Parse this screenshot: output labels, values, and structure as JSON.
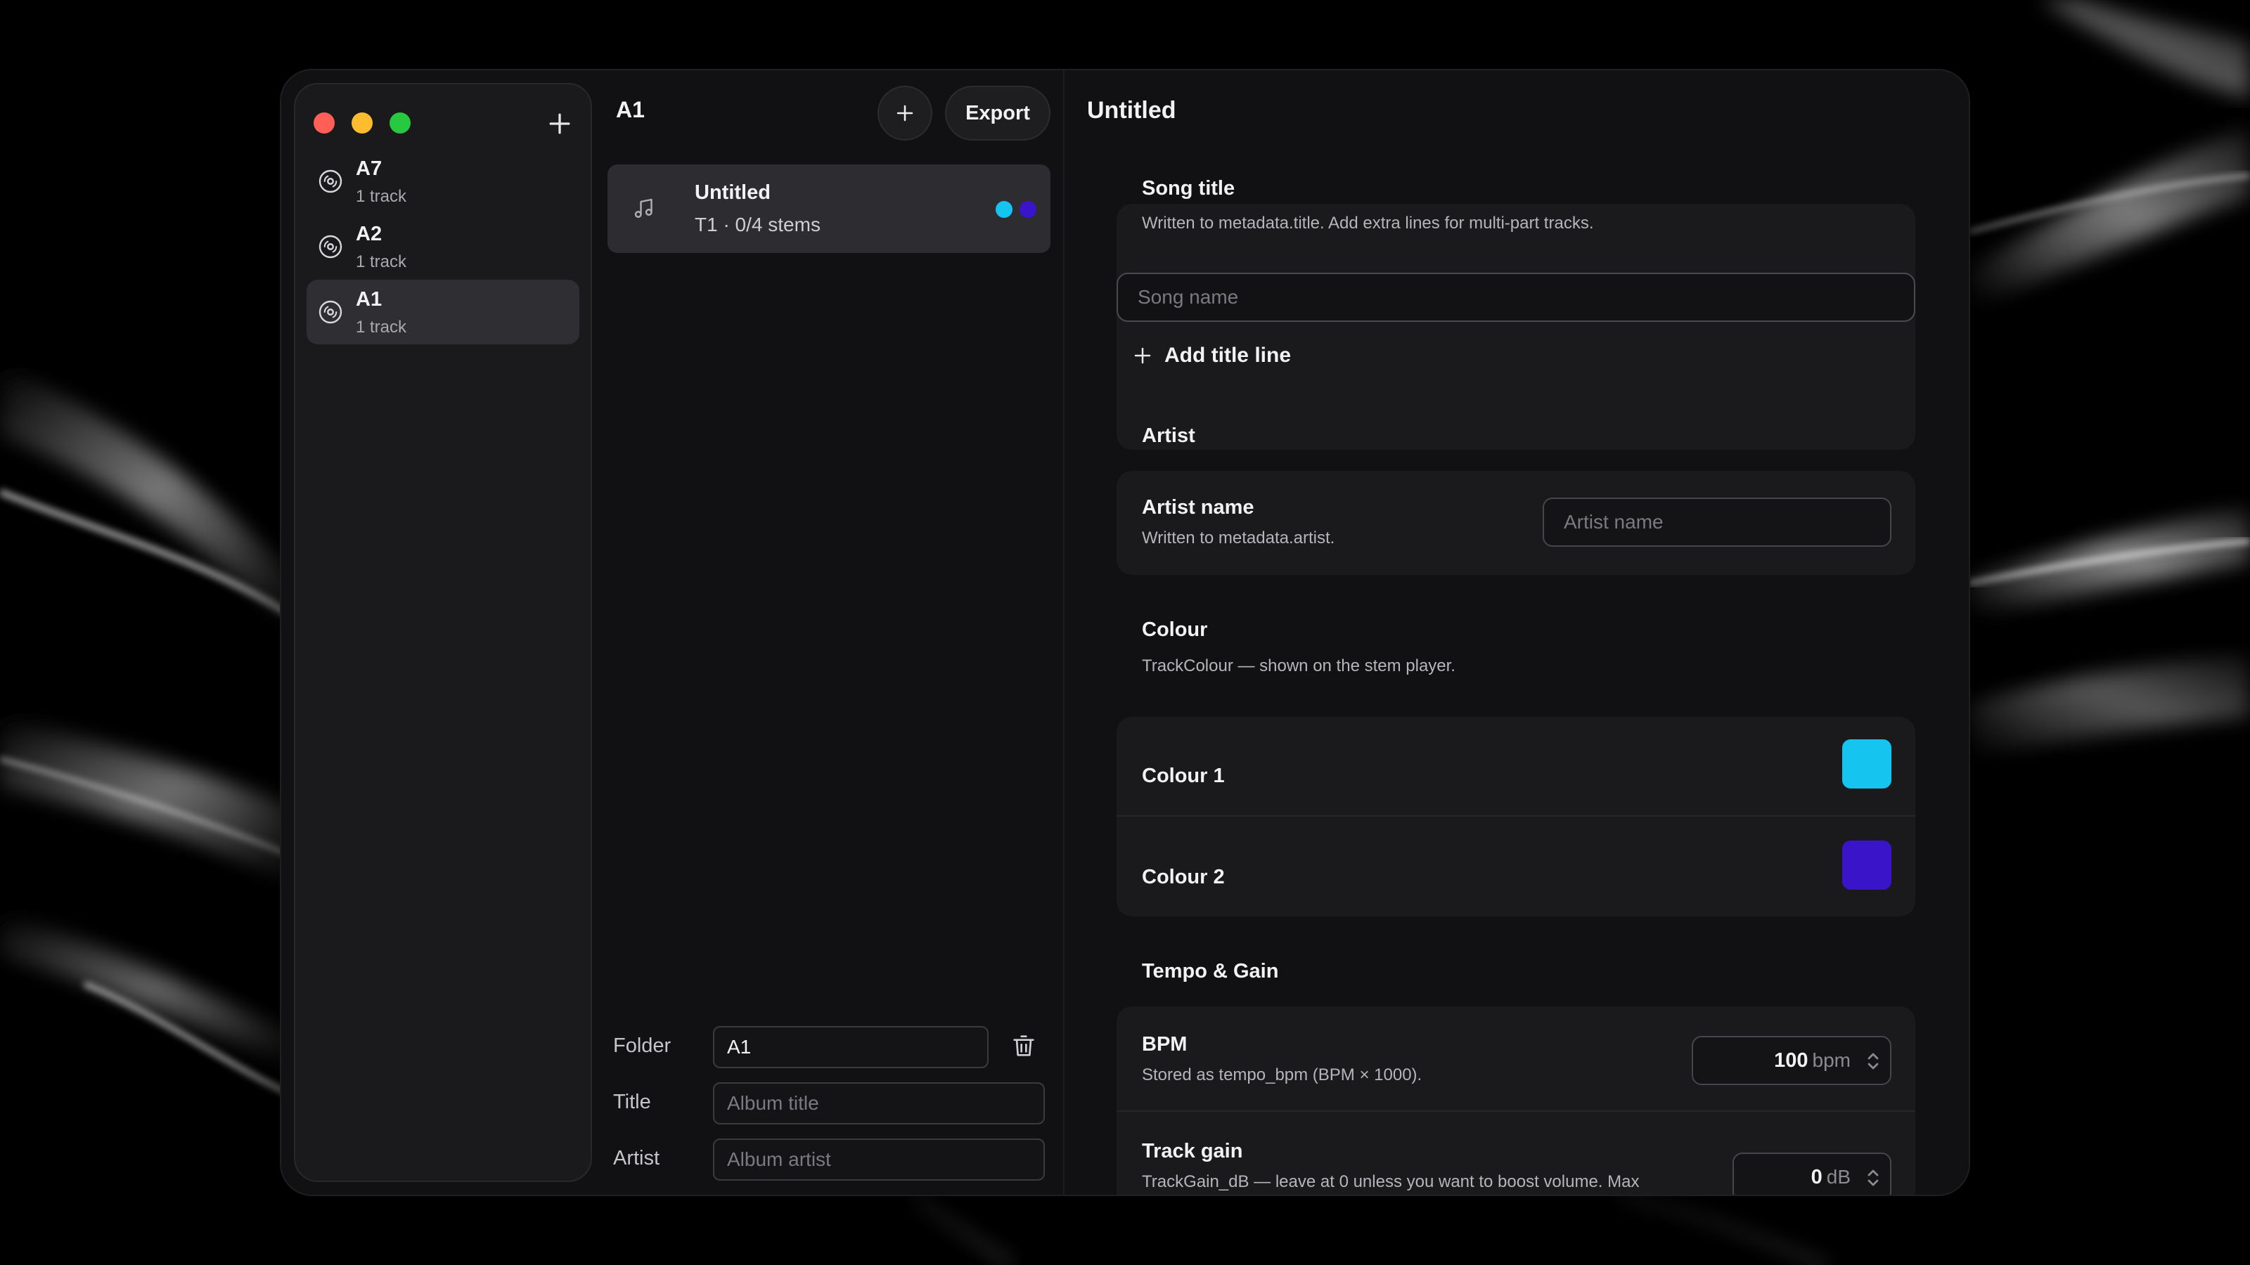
{
  "sidebar": {
    "items": [
      {
        "title": "A7",
        "subtitle": "1 track"
      },
      {
        "title": "A2",
        "subtitle": "1 track"
      },
      {
        "title": "A1",
        "subtitle": "1 track"
      }
    ],
    "active_index": 2
  },
  "middle": {
    "title": "A1",
    "export_label": "Export",
    "track": {
      "title": "Untitled",
      "subtitle": "T1 · 0/4 stems",
      "colors": [
        "#16c4f0",
        "#3a14c8"
      ]
    },
    "folder": {
      "label": "Folder",
      "value": "A1"
    },
    "title_field": {
      "label": "Title",
      "placeholder": "Album title"
    },
    "artist_field": {
      "label": "Artist",
      "placeholder": "Album artist"
    }
  },
  "detail": {
    "title": "Untitled",
    "song_title": {
      "heading": "Song title",
      "description": "Written to metadata.title. Add extra lines for multi-part tracks.",
      "placeholder": "Song name",
      "add_line_label": "Add title line"
    },
    "artist": {
      "heading": "Artist",
      "row_label": "Artist name",
      "row_description": "Written to metadata.artist.",
      "placeholder": "Artist name"
    },
    "colour": {
      "heading": "Colour",
      "description": "TrackColour — shown on the stem player.",
      "rows": [
        {
          "label": "Colour 1",
          "color": "#16c4f0"
        },
        {
          "label": "Colour 2",
          "color": "#3a14c8"
        }
      ]
    },
    "tempo_gain": {
      "heading": "Tempo & Gain",
      "bpm": {
        "label": "BPM",
        "description": "Stored as tempo_bpm (BPM × 1000).",
        "value": "100",
        "unit": "bpm"
      },
      "gain": {
        "label": "Track gain",
        "description": "TrackGain_dB — leave at 0 unless you want to boost volume. Max",
        "value": "0",
        "unit": "dB"
      }
    }
  },
  "icons": {
    "traffic_lights": [
      "#ff5f57",
      "#febc2e",
      "#28c840"
    ],
    "sidebar_item": "disc-icon",
    "track": "music-note-icon",
    "add": "plus-icon",
    "delete": "trash-icon"
  }
}
